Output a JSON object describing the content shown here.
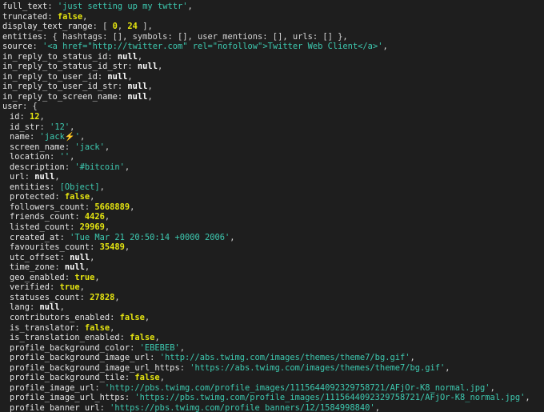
{
  "lines": [
    {
      "indent": false,
      "parts": [
        {
          "t": "k",
          "v": "full_text"
        },
        {
          "t": "p",
          "v": ": "
        },
        {
          "t": "string",
          "v": "'just setting up my twttr'"
        },
        {
          "t": "p",
          "v": ","
        }
      ]
    },
    {
      "indent": false,
      "parts": [
        {
          "t": "k",
          "v": "truncated"
        },
        {
          "t": "p",
          "v": ": "
        },
        {
          "t": "bool",
          "v": "false"
        },
        {
          "t": "p",
          "v": ","
        }
      ]
    },
    {
      "indent": false,
      "parts": [
        {
          "t": "k",
          "v": "display_text_range"
        },
        {
          "t": "p",
          "v": ": [ "
        },
        {
          "t": "num",
          "v": "0"
        },
        {
          "t": "p",
          "v": ", "
        },
        {
          "t": "num",
          "v": "24"
        },
        {
          "t": "p",
          "v": " ],"
        }
      ]
    },
    {
      "indent": false,
      "parts": [
        {
          "t": "k",
          "v": "entities"
        },
        {
          "t": "p",
          "v": ": { hashtags: [], symbols: [], user_mentions: [], urls: [] },"
        }
      ]
    },
    {
      "indent": false,
      "parts": [
        {
          "t": "k",
          "v": "source"
        },
        {
          "t": "p",
          "v": ": "
        },
        {
          "t": "string",
          "v": "'<a href=\"http://twitter.com\" rel=\"nofollow\">Twitter Web Client</a>'"
        },
        {
          "t": "p",
          "v": ","
        }
      ]
    },
    {
      "indent": false,
      "parts": [
        {
          "t": "k",
          "v": "in_reply_to_status_id"
        },
        {
          "t": "p",
          "v": ": "
        },
        {
          "t": "null",
          "v": "null"
        },
        {
          "t": "p",
          "v": ","
        }
      ]
    },
    {
      "indent": false,
      "parts": [
        {
          "t": "k",
          "v": "in_reply_to_status_id_str"
        },
        {
          "t": "p",
          "v": ": "
        },
        {
          "t": "null",
          "v": "null"
        },
        {
          "t": "p",
          "v": ","
        }
      ]
    },
    {
      "indent": false,
      "parts": [
        {
          "t": "k",
          "v": "in_reply_to_user_id"
        },
        {
          "t": "p",
          "v": ": "
        },
        {
          "t": "null",
          "v": "null"
        },
        {
          "t": "p",
          "v": ","
        }
      ]
    },
    {
      "indent": false,
      "parts": [
        {
          "t": "k",
          "v": "in_reply_to_user_id_str"
        },
        {
          "t": "p",
          "v": ": "
        },
        {
          "t": "null",
          "v": "null"
        },
        {
          "t": "p",
          "v": ","
        }
      ]
    },
    {
      "indent": false,
      "parts": [
        {
          "t": "k",
          "v": "in_reply_to_screen_name"
        },
        {
          "t": "p",
          "v": ": "
        },
        {
          "t": "null",
          "v": "null"
        },
        {
          "t": "p",
          "v": ","
        }
      ]
    },
    {
      "indent": false,
      "parts": [
        {
          "t": "k",
          "v": "user"
        },
        {
          "t": "p",
          "v": ": {"
        }
      ]
    },
    {
      "indent": true,
      "parts": [
        {
          "t": "k",
          "v": "id"
        },
        {
          "t": "p",
          "v": ": "
        },
        {
          "t": "num",
          "v": "12"
        },
        {
          "t": "p",
          "v": ","
        }
      ]
    },
    {
      "indent": true,
      "parts": [
        {
          "t": "k",
          "v": "id_str"
        },
        {
          "t": "p",
          "v": ": "
        },
        {
          "t": "string",
          "v": "'12'"
        },
        {
          "t": "p",
          "v": ","
        }
      ]
    },
    {
      "indent": true,
      "parts": [
        {
          "t": "k",
          "v": "name"
        },
        {
          "t": "p",
          "v": ": "
        },
        {
          "t": "string",
          "v": "'jack⚡️'"
        },
        {
          "t": "p",
          "v": ","
        }
      ]
    },
    {
      "indent": true,
      "parts": [
        {
          "t": "k",
          "v": "screen_name"
        },
        {
          "t": "p",
          "v": ": "
        },
        {
          "t": "string",
          "v": "'jack'"
        },
        {
          "t": "p",
          "v": ","
        }
      ]
    },
    {
      "indent": true,
      "parts": [
        {
          "t": "k",
          "v": "location"
        },
        {
          "t": "p",
          "v": ": "
        },
        {
          "t": "string",
          "v": "''"
        },
        {
          "t": "p",
          "v": ","
        }
      ]
    },
    {
      "indent": true,
      "parts": [
        {
          "t": "k",
          "v": "description"
        },
        {
          "t": "p",
          "v": ": "
        },
        {
          "t": "string",
          "v": "'#bitcoin'"
        },
        {
          "t": "p",
          "v": ","
        }
      ]
    },
    {
      "indent": true,
      "parts": [
        {
          "t": "k",
          "v": "url"
        },
        {
          "t": "p",
          "v": ": "
        },
        {
          "t": "null",
          "v": "null"
        },
        {
          "t": "p",
          "v": ","
        }
      ]
    },
    {
      "indent": true,
      "parts": [
        {
          "t": "k",
          "v": "entities"
        },
        {
          "t": "p",
          "v": ": "
        },
        {
          "t": "obj",
          "v": "[Object]"
        },
        {
          "t": "p",
          "v": ","
        }
      ]
    },
    {
      "indent": true,
      "parts": [
        {
          "t": "k",
          "v": "protected"
        },
        {
          "t": "p",
          "v": ": "
        },
        {
          "t": "bool",
          "v": "false"
        },
        {
          "t": "p",
          "v": ","
        }
      ]
    },
    {
      "indent": true,
      "parts": [
        {
          "t": "k",
          "v": "followers_count"
        },
        {
          "t": "p",
          "v": ": "
        },
        {
          "t": "num",
          "v": "5668889"
        },
        {
          "t": "p",
          "v": ","
        }
      ]
    },
    {
      "indent": true,
      "parts": [
        {
          "t": "k",
          "v": "friends_count"
        },
        {
          "t": "p",
          "v": ": "
        },
        {
          "t": "num",
          "v": "4426"
        },
        {
          "t": "p",
          "v": ","
        }
      ]
    },
    {
      "indent": true,
      "parts": [
        {
          "t": "k",
          "v": "listed_count"
        },
        {
          "t": "p",
          "v": ": "
        },
        {
          "t": "num",
          "v": "29969"
        },
        {
          "t": "p",
          "v": ","
        }
      ]
    },
    {
      "indent": true,
      "parts": [
        {
          "t": "k",
          "v": "created_at"
        },
        {
          "t": "p",
          "v": ": "
        },
        {
          "t": "string",
          "v": "'Tue Mar 21 20:50:14 +0000 2006'"
        },
        {
          "t": "p",
          "v": ","
        }
      ]
    },
    {
      "indent": true,
      "parts": [
        {
          "t": "k",
          "v": "favourites_count"
        },
        {
          "t": "p",
          "v": ": "
        },
        {
          "t": "num",
          "v": "35489"
        },
        {
          "t": "p",
          "v": ","
        }
      ]
    },
    {
      "indent": true,
      "parts": [
        {
          "t": "k",
          "v": "utc_offset"
        },
        {
          "t": "p",
          "v": ": "
        },
        {
          "t": "null",
          "v": "null"
        },
        {
          "t": "p",
          "v": ","
        }
      ]
    },
    {
      "indent": true,
      "parts": [
        {
          "t": "k",
          "v": "time_zone"
        },
        {
          "t": "p",
          "v": ": "
        },
        {
          "t": "null",
          "v": "null"
        },
        {
          "t": "p",
          "v": ","
        }
      ]
    },
    {
      "indent": true,
      "parts": [
        {
          "t": "k",
          "v": "geo_enabled"
        },
        {
          "t": "p",
          "v": ": "
        },
        {
          "t": "bool",
          "v": "true"
        },
        {
          "t": "p",
          "v": ","
        }
      ]
    },
    {
      "indent": true,
      "parts": [
        {
          "t": "k",
          "v": "verified"
        },
        {
          "t": "p",
          "v": ": "
        },
        {
          "t": "bool",
          "v": "true"
        },
        {
          "t": "p",
          "v": ","
        }
      ]
    },
    {
      "indent": true,
      "parts": [
        {
          "t": "k",
          "v": "statuses_count"
        },
        {
          "t": "p",
          "v": ": "
        },
        {
          "t": "num",
          "v": "27828"
        },
        {
          "t": "p",
          "v": ","
        }
      ]
    },
    {
      "indent": true,
      "parts": [
        {
          "t": "k",
          "v": "lang"
        },
        {
          "t": "p",
          "v": ": "
        },
        {
          "t": "null",
          "v": "null"
        },
        {
          "t": "p",
          "v": ","
        }
      ]
    },
    {
      "indent": true,
      "parts": [
        {
          "t": "k",
          "v": "contributors_enabled"
        },
        {
          "t": "p",
          "v": ": "
        },
        {
          "t": "bool",
          "v": "false"
        },
        {
          "t": "p",
          "v": ","
        }
      ]
    },
    {
      "indent": true,
      "parts": [
        {
          "t": "k",
          "v": "is_translator"
        },
        {
          "t": "p",
          "v": ": "
        },
        {
          "t": "bool",
          "v": "false"
        },
        {
          "t": "p",
          "v": ","
        }
      ]
    },
    {
      "indent": true,
      "parts": [
        {
          "t": "k",
          "v": "is_translation_enabled"
        },
        {
          "t": "p",
          "v": ": "
        },
        {
          "t": "bool",
          "v": "false"
        },
        {
          "t": "p",
          "v": ","
        }
      ]
    },
    {
      "indent": true,
      "parts": [
        {
          "t": "k",
          "v": "profile_background_color"
        },
        {
          "t": "p",
          "v": ": "
        },
        {
          "t": "string",
          "v": "'EBEBEB'"
        },
        {
          "t": "p",
          "v": ","
        }
      ]
    },
    {
      "indent": true,
      "parts": [
        {
          "t": "k",
          "v": "profile_background_image_url"
        },
        {
          "t": "p",
          "v": ": "
        },
        {
          "t": "string",
          "v": "'http://abs.twimg.com/images/themes/theme7/bg.gif'"
        },
        {
          "t": "p",
          "v": ","
        }
      ]
    },
    {
      "indent": true,
      "parts": [
        {
          "t": "k",
          "v": "profile_background_image_url_https"
        },
        {
          "t": "p",
          "v": ": "
        },
        {
          "t": "string",
          "v": "'https://abs.twimg.com/images/themes/theme7/bg.gif'"
        },
        {
          "t": "p",
          "v": ","
        }
      ]
    },
    {
      "indent": true,
      "parts": [
        {
          "t": "k",
          "v": "profile_background_tile"
        },
        {
          "t": "p",
          "v": ": "
        },
        {
          "t": "bool",
          "v": "false"
        },
        {
          "t": "p",
          "v": ","
        }
      ]
    },
    {
      "indent": true,
      "parts": [
        {
          "t": "k",
          "v": "profile_image_url"
        },
        {
          "t": "p",
          "v": ": "
        },
        {
          "t": "string",
          "v": "'http://pbs.twimg.com/profile_images/1115644092329758721/AFjOr-K8_normal.jpg'"
        },
        {
          "t": "p",
          "v": ","
        }
      ]
    },
    {
      "indent": true,
      "parts": [
        {
          "t": "k",
          "v": "profile_image_url_https"
        },
        {
          "t": "p",
          "v": ": "
        },
        {
          "t": "string",
          "v": "'https://pbs.twimg.com/profile_images/1115644092329758721/AFjOr-K8_normal.jpg'"
        },
        {
          "t": "p",
          "v": ","
        }
      ]
    },
    {
      "indent": true,
      "parts": [
        {
          "t": "k",
          "v": "profile_banner_url"
        },
        {
          "t": "p",
          "v": ": "
        },
        {
          "t": "string",
          "v": "'https://pbs.twimg.com/profile_banners/12/1584998840'"
        },
        {
          "t": "p",
          "v": ","
        }
      ]
    }
  ]
}
